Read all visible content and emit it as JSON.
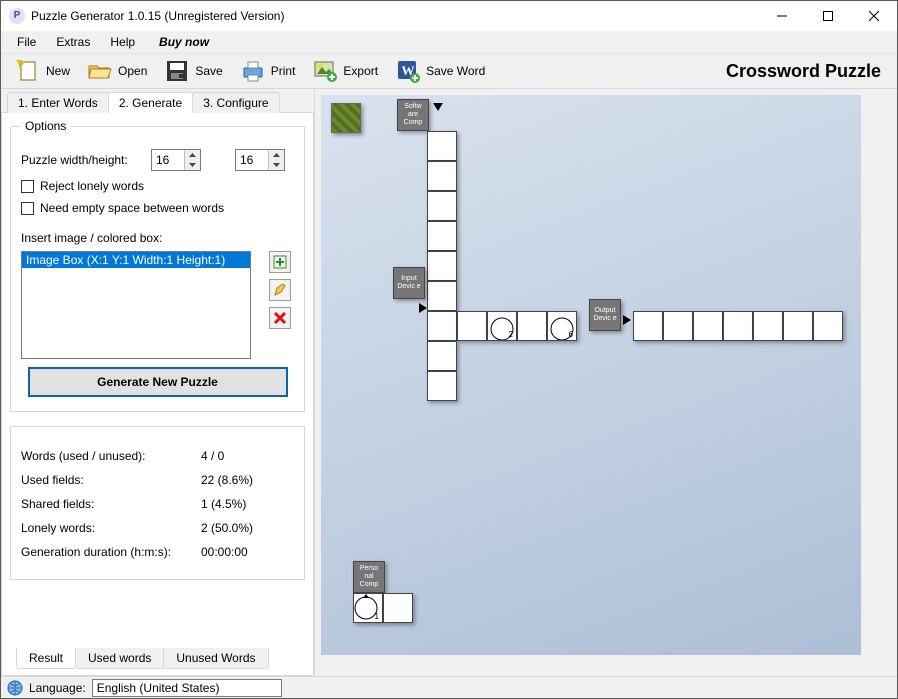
{
  "window": {
    "title": "Puzzle Generator 1.0.15 (Unregistered Version)"
  },
  "menu": {
    "file": "File",
    "extras": "Extras",
    "help": "Help",
    "buy": "Buy now"
  },
  "toolbar": {
    "new": "New",
    "open": "Open",
    "save": "Save",
    "print": "Print",
    "export": "Export",
    "save_word": "Save Word",
    "app_title": "Crossword Puzzle"
  },
  "tabs_top": {
    "t1": "1. Enter Words",
    "t2": "2. Generate",
    "t3": "3. Configure"
  },
  "options": {
    "legend": "Options",
    "size_label": "Puzzle width/height:",
    "width": "16",
    "height": "16",
    "reject": "Reject lonely words",
    "need_space": "Need empty space between words",
    "insert_img_label": "Insert image / colored box:",
    "img_item": "Image Box (X:1 Y:1 Width:1 Height:1)",
    "generate": "Generate New Puzzle"
  },
  "stats": {
    "words_k": "Words (used / unused):",
    "words_v": "4 / 0",
    "used_fields_k": "Used fields:",
    "used_fields_v": "22 (8.6%)",
    "shared_k": "Shared fields:",
    "shared_v": "1 (4.5%)",
    "lonely_k": "Lonely words:",
    "lonely_v": "2 (50.0%)",
    "duration_k": "Generation duration (h:m:s):",
    "duration_v": "00:00:00"
  },
  "tabs_bottom": {
    "result": "Result",
    "used": "Used words",
    "unused": "Unused Words"
  },
  "status": {
    "lang_label": "Language:",
    "lang_value": "English (United States)"
  },
  "canvas": {
    "clue_software": "Softw\nare\nComp",
    "clue_input": "Input\nDevic\ne",
    "clue_output": "Output\nDevic\ne",
    "clue_personal": "Perso\nnal\nComp",
    "n1": "1",
    "n2": "2",
    "n6": "6"
  }
}
